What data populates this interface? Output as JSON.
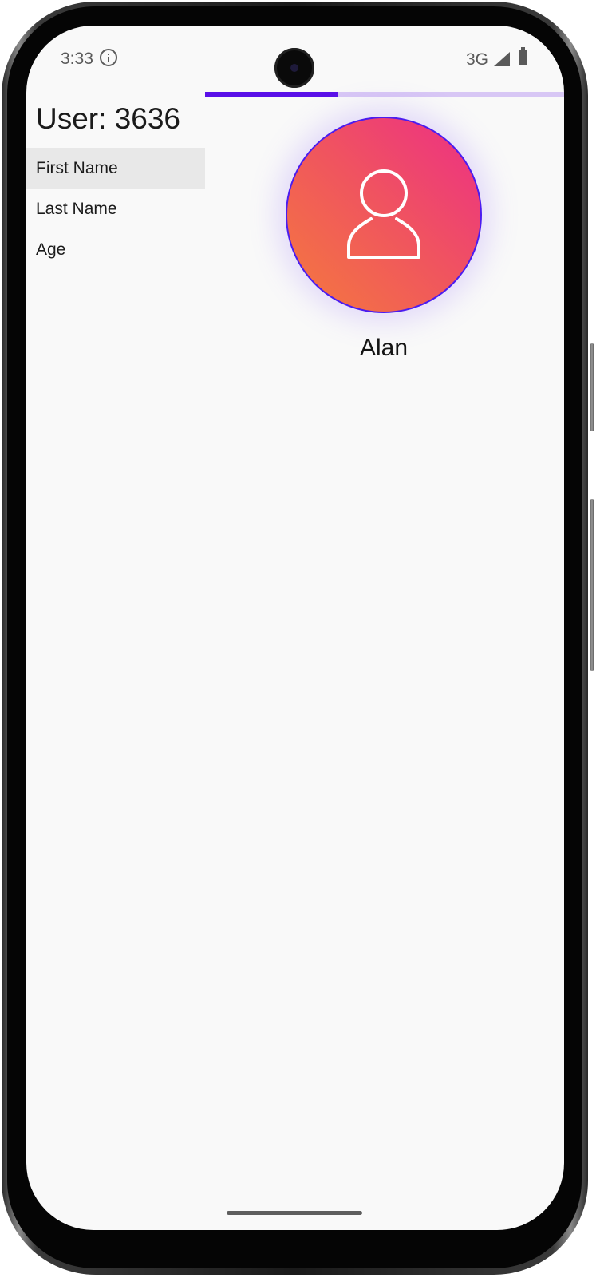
{
  "status_bar": {
    "time": "3:33",
    "network": "3G",
    "icons": [
      "info-icon",
      "signal-icon",
      "battery-icon"
    ]
  },
  "page_indicator": {
    "fraction_complete": 0.37,
    "active_color": "#5a10e8",
    "track_color": "#d8c7f5"
  },
  "user": {
    "title": "User: 3636",
    "name": "Alan",
    "avatar_icon": "person-icon"
  },
  "fields": [
    {
      "label": "First Name",
      "selected": true
    },
    {
      "label": "Last Name",
      "selected": false
    },
    {
      "label": "Age",
      "selected": false
    }
  ],
  "colors": {
    "avatar_gradient_start": "#ec2e86",
    "avatar_gradient_end": "#f57a3d",
    "avatar_border": "#4b1cf0",
    "selected_row": "#e8e8e8",
    "screen_background": "#f9f9f9"
  }
}
